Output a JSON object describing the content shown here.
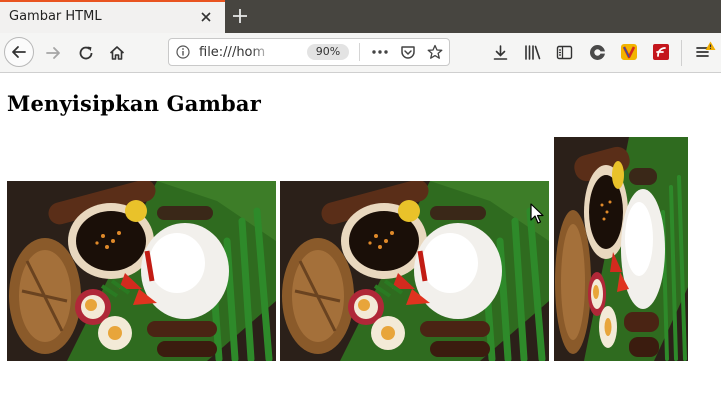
{
  "browser": {
    "tab": {
      "title": "Gambar HTML"
    },
    "urlbar": {
      "url": "file:///hom",
      "zoom": "90%"
    },
    "colors": {
      "accent": "#e95420",
      "tabstrip": "#474540",
      "toolbar": "#f5f5f4"
    },
    "toolbar_icons": [
      "back-icon",
      "forward-icon",
      "reload-icon",
      "home-icon",
      "info-icon",
      "page-actions-icon",
      "pocket-icon",
      "bookmark-star-icon",
      "download-icon",
      "library-icon",
      "sidebar-icon",
      "extension-icon",
      "vivaldi-icon",
      "flash-icon",
      "menu-icon"
    ]
  },
  "page": {
    "heading": "Menyisipkan Gambar",
    "images": [
      {
        "name": "food-image-1",
        "subject": "nasi liwet platter"
      },
      {
        "name": "food-image-2",
        "subject": "nasi liwet platter"
      },
      {
        "name": "food-image-3",
        "subject": "nasi liwet platter (narrow)"
      }
    ]
  }
}
